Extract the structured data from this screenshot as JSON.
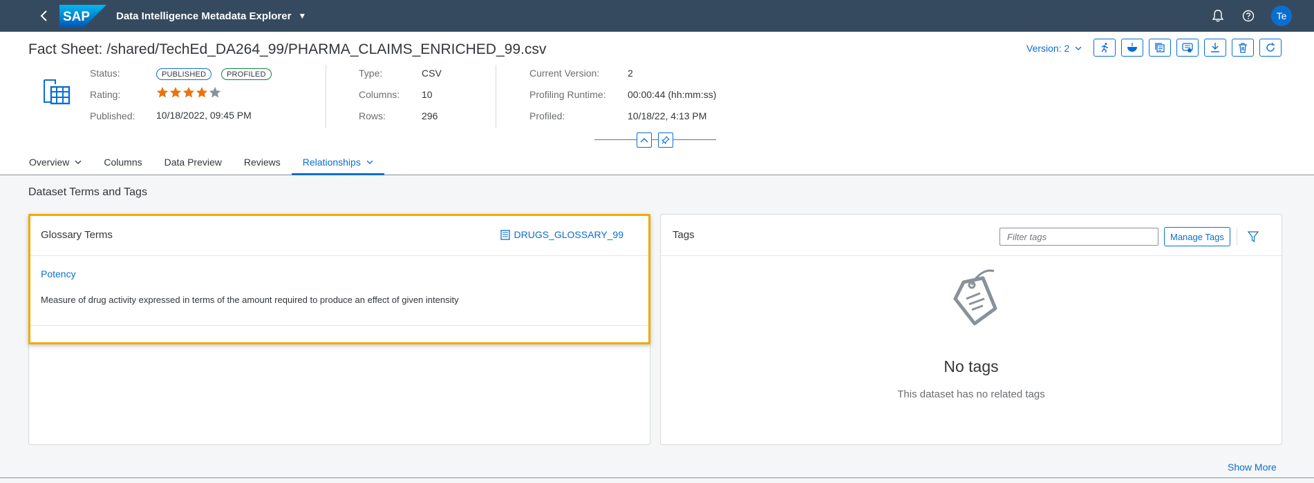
{
  "shell": {
    "brand": "SAP",
    "app_title": "Data Intelligence Metadata Explorer",
    "avatar_initials": "Te",
    "icons": [
      "back-icon",
      "chevron-down-icon",
      "bell-icon",
      "help-icon"
    ]
  },
  "header": {
    "title": "Fact Sheet: /shared/TechEd_DA264_99/PHARMA_CLAIMS_ENRICHED_99.csv",
    "version_label": "Version: 2",
    "toolbar_icons": [
      "run-profile-icon",
      "bowl-icon",
      "copy-icon",
      "publish-icon",
      "download-icon",
      "delete-icon",
      "refresh-icon"
    ],
    "status_label": "Status:",
    "badges": [
      "PUBLISHED",
      "PROFILED"
    ],
    "rating_label": "Rating:",
    "rating": 4,
    "rating_max": 5,
    "published_label": "Published:",
    "published_value": "10/18/2022, 09:45 PM",
    "type_label": "Type:",
    "type_value": "CSV",
    "columns_label": "Columns:",
    "columns_value": "10",
    "rows_label": "Rows:",
    "rows_value": "296",
    "current_version_label": "Current Version:",
    "current_version_value": "2",
    "profiling_runtime_label": "Profiling Runtime:",
    "profiling_runtime_value": "00:00:44 (hh:mm:ss)",
    "profiled_label": "Profiled:",
    "profiled_value": "10/18/22, 4:13 PM"
  },
  "tabs": [
    {
      "label": "Overview",
      "has_menu": true,
      "active": false
    },
    {
      "label": "Columns",
      "has_menu": false,
      "active": false
    },
    {
      "label": "Data Preview",
      "has_menu": false,
      "active": false
    },
    {
      "label": "Reviews",
      "has_menu": false,
      "active": false
    },
    {
      "label": "Relationships",
      "has_menu": true,
      "active": true
    }
  ],
  "content": {
    "section_title": "Dataset Terms and Tags",
    "glossary": {
      "title": "Glossary Terms",
      "glossary_name": "DRUGS_GLOSSARY_99",
      "term": "Potency",
      "description": "Measure of drug activity expressed in terms of the amount required to produce an effect of given intensity"
    },
    "tags": {
      "title": "Tags",
      "filter_placeholder": "Filter tags",
      "manage_label": "Manage Tags",
      "empty_title": "No tags",
      "empty_sub": "This dataset has no related tags"
    },
    "show_more": "Show More"
  },
  "colors": {
    "shell_bg": "#354a5f",
    "accent": "#0a6ed1",
    "highlight": "#f0ab00",
    "star": "#e9730c"
  }
}
